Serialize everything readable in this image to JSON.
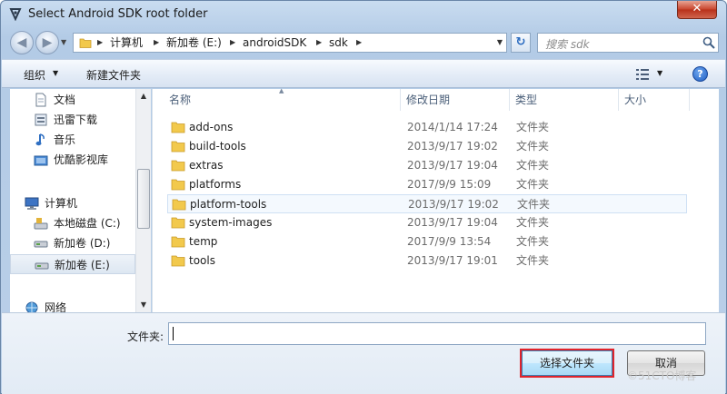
{
  "window": {
    "title": "Select Android SDK root folder",
    "close_glyph": "✕"
  },
  "nav": {
    "back_glyph": "◀",
    "forward_glyph": "▶",
    "breadcrumbs": [
      "计算机",
      "新加卷 (E:)",
      "androidSDK",
      "sdk"
    ],
    "search_placeholder": "搜索 sdk"
  },
  "toolbar": {
    "organize_label": "组织",
    "new_folder_label": "新建文件夹",
    "help_glyph": "?"
  },
  "sidebar": {
    "items": [
      {
        "label": "文档",
        "icon": "document-icon"
      },
      {
        "label": "迅雷下载",
        "icon": "download-icon"
      },
      {
        "label": "音乐",
        "icon": "music-icon"
      },
      {
        "label": "优酷影视库",
        "icon": "video-library-icon"
      },
      {
        "label": "计算机",
        "icon": "computer-icon"
      },
      {
        "label": "本地磁盘 (C:)",
        "icon": "system-drive-icon"
      },
      {
        "label": "新加卷 (D:)",
        "icon": "drive-icon"
      },
      {
        "label": "新加卷 (E:)",
        "icon": "drive-icon",
        "selected": true
      },
      {
        "label": "网络",
        "icon": "network-icon"
      }
    ]
  },
  "columns": {
    "name": "名称",
    "modified": "修改日期",
    "type": "类型",
    "size": "大小"
  },
  "files": [
    {
      "name": "add-ons",
      "modified": "2014/1/14 17:24",
      "type": "文件夹"
    },
    {
      "name": "build-tools",
      "modified": "2013/9/17 19:02",
      "type": "文件夹"
    },
    {
      "name": "extras",
      "modified": "2013/9/17 19:04",
      "type": "文件夹"
    },
    {
      "name": "platforms",
      "modified": "2017/9/9 15:09",
      "type": "文件夹"
    },
    {
      "name": "platform-tools",
      "modified": "2013/9/17 19:02",
      "type": "文件夹",
      "highlighted": true
    },
    {
      "name": "system-images",
      "modified": "2013/9/17 19:04",
      "type": "文件夹"
    },
    {
      "name": "temp",
      "modified": "2017/9/9 13:54",
      "type": "文件夹"
    },
    {
      "name": "tools",
      "modified": "2013/9/17 19:01",
      "type": "文件夹"
    }
  ],
  "footer": {
    "folder_label": "文件夹:",
    "folder_value": "",
    "select_button": "选择文件夹",
    "cancel_button": "取消"
  },
  "watermark": "©51CTO博客",
  "colors": {
    "highlight_border": "#e0242c",
    "folder_yellow": "#f2c94c"
  }
}
